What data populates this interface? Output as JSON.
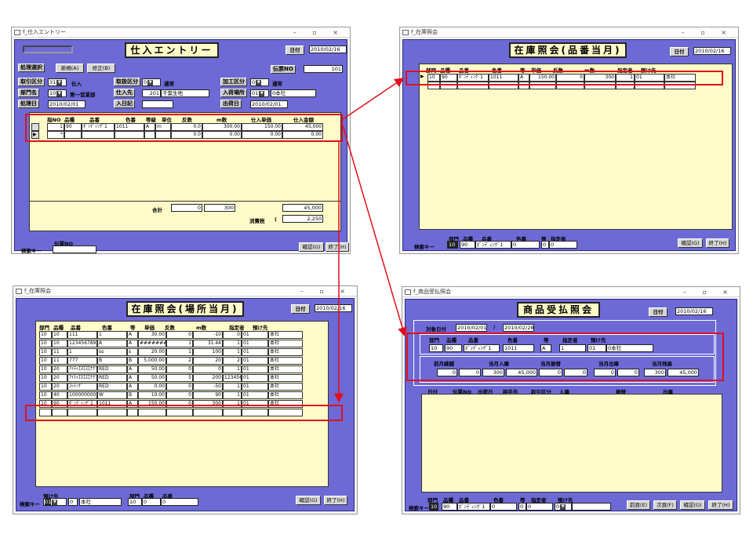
{
  "w1": {
    "title": "f_仕入エントリー",
    "heading": "仕入エントリー",
    "date_label": "日付",
    "date": "2010/02/16",
    "mode_label": "処理選択",
    "new_btn": "新規(A)",
    "fix_btn": "修正(B)",
    "slip_label": "伝票NO",
    "slip_no": "101",
    "torihiki_label": "取引区分",
    "torihiki_code": "31",
    "torihiki_name": "仕入",
    "keigen_label": "取扱区分",
    "keigen_code": "0",
    "keigen_name": "通常",
    "kakou_label": "加工区分",
    "kakou_code": "0",
    "kakou_name": "通常",
    "bumon_label": "部門名",
    "bumon_code": "10",
    "bumon_name": "第一営業部",
    "shiire_label": "仕入先",
    "shiire_code": "201",
    "shiire_name": "千葉生地",
    "nyuka_label": "入荷場所",
    "nyuka_code": "01",
    "nyuka_name": "0本社",
    "shori_label": "処理日",
    "shori_date": "2010/02/01",
    "nyuki_label": "入日記",
    "shukka_label": "出荷日",
    "shukka_date": "2010/02/01",
    "cols": [
      "指NO",
      "品種",
      "品番",
      "色番",
      "等級",
      "単位",
      "反数",
      "m数",
      "仕入単価",
      "仕入金額"
    ],
    "row1": [
      "1",
      "90",
      "ﾎﾞﾝﾃﾞｨﾝｸﾞ1",
      "1011",
      "A",
      "m",
      "0.0",
      "300.00",
      "150.00",
      "45,000"
    ],
    "row2": [
      "*",
      "",
      "",
      "",
      "",
      "",
      "0.0",
      "0.00",
      "0.00",
      "0.00"
    ],
    "total_label": "合計",
    "total_tan": "0",
    "total_m": "300",
    "total_amt": "45,000",
    "tax_label": "消費税",
    "tax_paren": "(",
    "tax": "2,250",
    ")": ")",
    "confirm": "確認(G)",
    "end": "終了(H)",
    "search_label": "検索キー",
    "search_col": "伝票NO"
  },
  "w2": {
    "title": "f_在庫照会",
    "heading": "在庫照会(品番当月)",
    "date_label": "日付",
    "date": "2010/02/16",
    "cols": [
      "部門",
      "品種",
      "品番",
      "色番",
      "等",
      "単価",
      "反数",
      "m数",
      "指定者",
      "預け先"
    ],
    "row1": [
      "10",
      "90",
      "ﾎﾞﾝﾃﾞｨﾝｸﾞ1",
      "1011",
      "A",
      "150.00",
      "0",
      "300",
      "1",
      "01",
      "本社"
    ],
    "search_label": "検索キー",
    "search_cols": [
      "部門",
      "品種",
      "品番",
      "色番",
      "等",
      "指定者"
    ],
    "search_vals": [
      "10",
      "90",
      "ﾎﾞﾝﾃﾞｨﾝｸﾞ1",
      "0",
      "0",
      "0"
    ],
    "confirm": "確認(G)",
    "end": "終了(H)"
  },
  "w3": {
    "title": "f_在庫照会",
    "heading": "在庫照会(場所当月)",
    "date_label": "日付",
    "date": "2010/02/16",
    "cols": [
      "部門",
      "品種",
      "品番",
      "色番",
      "等",
      "単価",
      "反数",
      "m数",
      "指定者",
      "預け先"
    ],
    "rows": [
      [
        "10",
        "10",
        "111",
        "1",
        "A",
        "30.00",
        "0",
        "-10",
        "0",
        "01",
        "本社"
      ],
      [
        "10",
        "10",
        "1234567891",
        "A",
        "A",
        "########",
        "1",
        "31.44",
        "1",
        "01",
        "本社"
      ],
      [
        "10",
        "11",
        "1",
        "ss",
        "s",
        "20.00",
        "1",
        "100",
        "1",
        "01",
        "本社"
      ],
      [
        "10",
        "11",
        "777",
        "B",
        "B",
        "5,000.00",
        "2",
        "20",
        "2",
        "01",
        "本社"
      ],
      [
        "10",
        "20",
        "ｱｲﾃｨｴﾇｴｽｴﾅｸﾞ",
        "RED",
        "A",
        "50.00",
        "0",
        "0",
        "1",
        "01",
        "本社"
      ],
      [
        "10",
        "20",
        "ｱｲﾃｨｴﾇｴｽｴﾅｸﾞ",
        "RED",
        "A",
        "50.00",
        "5",
        "200",
        "123456",
        "01",
        "本社"
      ],
      [
        "10",
        "20",
        "ｺｯﾄﾝｹﾞ",
        "RED",
        "A",
        "0.00",
        "0",
        "-50",
        "1",
        "01",
        "本社"
      ],
      [
        "10",
        "40",
        "1000000001",
        "W",
        "B",
        "10.00",
        "0",
        "90",
        "1",
        "01",
        "本社"
      ],
      [
        "10",
        "90",
        "ﾎﾞﾝﾃﾞｨﾝｸﾞ1",
        "1011",
        "A",
        "150.00",
        "0",
        "300",
        "1",
        "01",
        "本社"
      ]
    ],
    "search_label": "検索キー",
    "search_cols": [
      "預け先",
      "部門",
      "品種",
      "品番"
    ],
    "search_vals": [
      "01",
      "0",
      "本社",
      "10",
      "0",
      "0"
    ],
    "confirm": "確認(G)",
    "end": "終了(H)"
  },
  "w4": {
    "title": "f_商品受払照会",
    "heading": "商品受払照会",
    "date_label": "日付",
    "date": "2010/02/16",
    "target_label": "対象日付",
    "from": "2010/02/01",
    "sep": "/",
    "to": "2010/02/28",
    "cols1": [
      "部門",
      "品種",
      "品番",
      "色番",
      "等",
      "指定者",
      "預け先"
    ],
    "vals1": [
      "10",
      "90",
      "ﾎﾞﾝﾃﾞｨﾝｸﾞ1",
      "1011",
      "A",
      "1",
      "01",
      "0本社"
    ],
    "cols2": [
      "前月繰越",
      "当月入庫",
      "当月振替",
      "当月出庫",
      "当月残高"
    ],
    "vals2": [
      "0",
      "0",
      "300",
      "45,000",
      "0",
      "0",
      "0",
      "0",
      "300",
      "45,000"
    ],
    "cols3": [
      "日付",
      "伝票NO",
      "出荷日",
      "相手先",
      "取引区分",
      "入庫",
      "振替",
      "出庫"
    ],
    "search_label": "検索キー",
    "search_cols": [
      "部門",
      "品種",
      "品番",
      "色番",
      "等",
      "指定者",
      "預け先"
    ],
    "search_vals": [
      "10",
      "90",
      "ﾎﾞﾝﾃﾞｨﾝｸﾞ1",
      "0",
      "0",
      "0",
      "0"
    ],
    "prev": "前頁(E)",
    "next": "次頁(F)",
    "confirm": "確認(G)",
    "end": "終了(H)"
  },
  "window_controls": "–  ▫  ×",
  "colors": {
    "panel": "#6d6ad6",
    "yellow": "#fffbc8",
    "red": "#e0101a"
  }
}
